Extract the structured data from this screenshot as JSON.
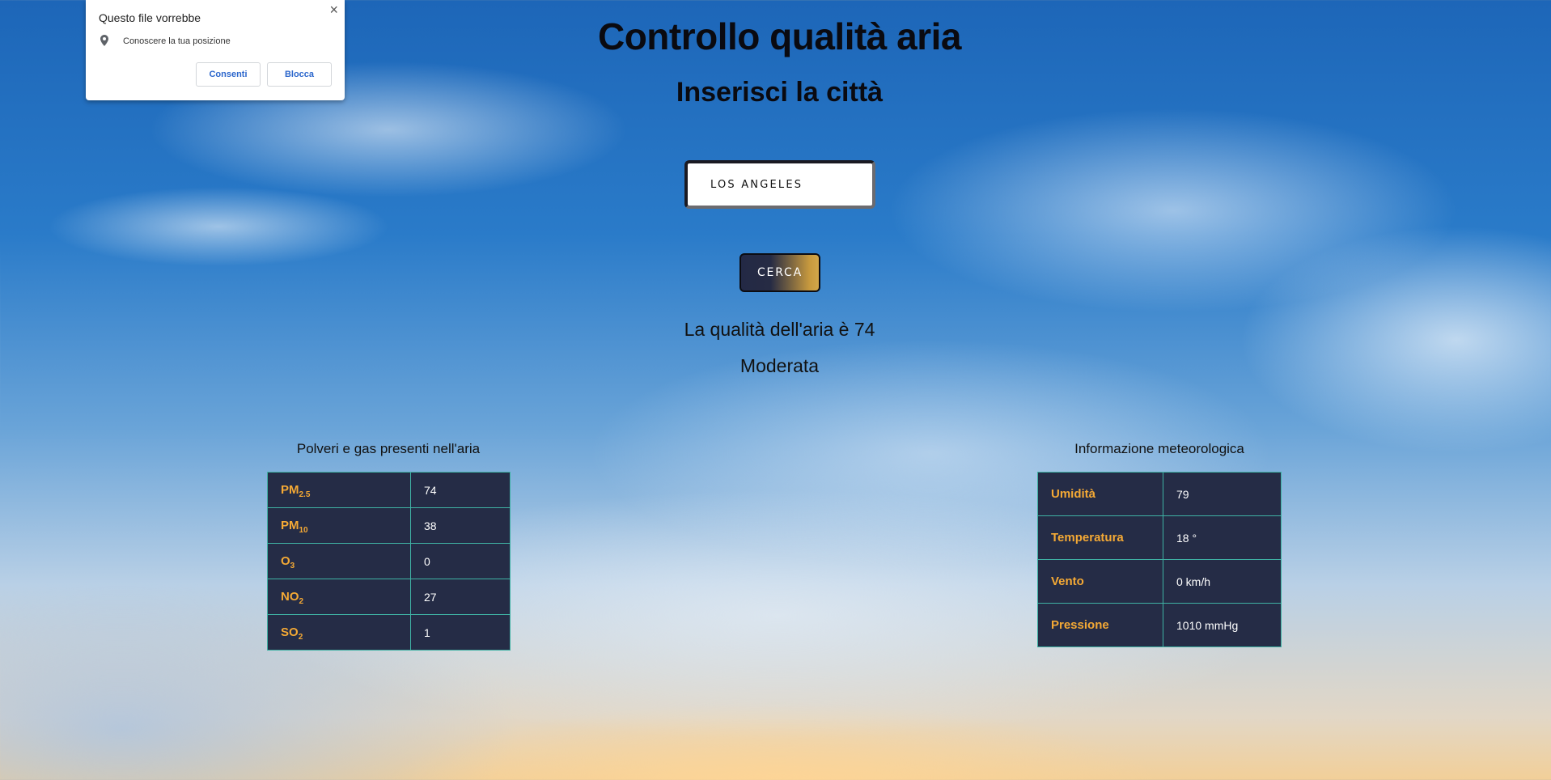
{
  "permission_popup": {
    "title": "Questo file vorrebbe",
    "close_glyph": "×",
    "location_icon": "location-pin-icon",
    "message": "Conoscere la tua posizione",
    "allow_label": "Consenti",
    "block_label": "Blocca"
  },
  "header": {
    "title": "Controllo qualità aria",
    "subtitle": "Inserisci la città"
  },
  "search": {
    "city_value": "LOS ANGELES",
    "button_label": "CERCA"
  },
  "result": {
    "aqi_text": "La qualità dell'aria è 74",
    "level": "Moderata"
  },
  "pollutants": {
    "caption": "Polveri e gas presenti nell'aria",
    "rows": [
      {
        "name": "PM",
        "sub": "2.5",
        "value": "74"
      },
      {
        "name": "PM",
        "sub": "10",
        "value": "38"
      },
      {
        "name": "O",
        "sub": "3",
        "value": "0"
      },
      {
        "name": "NO",
        "sub": "2",
        "value": "27"
      },
      {
        "name": "SO",
        "sub": "2",
        "value": "1"
      }
    ]
  },
  "weather": {
    "caption": "Informazione meteorologica",
    "rows": [
      {
        "name": "Umidità",
        "value": "79"
      },
      {
        "name": "Temperatura",
        "value": "18 °"
      },
      {
        "name": "Vento",
        "value": "0 km/h"
      },
      {
        "name": "Pressione",
        "value": "1010 mmHg"
      }
    ]
  },
  "colors": {
    "table_bg": "#252c46",
    "table_border": "#3fb2a4",
    "key_text": "#f4a935",
    "button_gradient_start": "#232945",
    "button_gradient_end": "#d2a74a"
  }
}
